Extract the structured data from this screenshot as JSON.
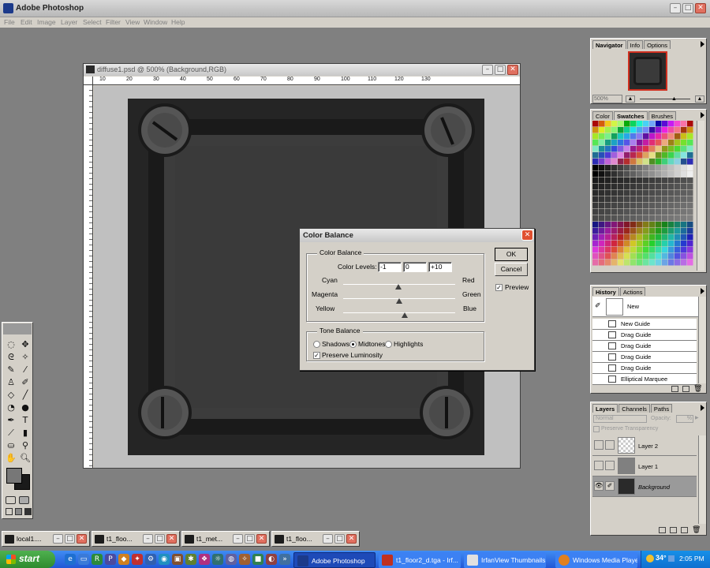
{
  "app": {
    "title": "Adobe Photoshop",
    "menu": [
      "File",
      "Edit",
      "Image",
      "Layer",
      "Select",
      "Filter",
      "View",
      "Window",
      "Help"
    ]
  },
  "document": {
    "title": "diffuse1.psd @ 500% (Background,RGB)",
    "ruler_labels": [
      "10",
      "20",
      "30",
      "40",
      "50",
      "60",
      "70",
      "80",
      "90",
      "100",
      "110",
      "120",
      "130"
    ]
  },
  "navigator": {
    "tabs": [
      "Navigator",
      "Info",
      "Options"
    ],
    "zoom": "500%"
  },
  "swatches_panel": {
    "tabs": [
      "Color",
      "Swatches",
      "Brushes"
    ]
  },
  "history": {
    "tabs": [
      "History",
      "Actions"
    ],
    "snapshot_label": "New",
    "items": [
      "New Guide",
      "Drag Guide",
      "Drag Guide",
      "Drag Guide",
      "Drag Guide",
      "Elliptical Marquee"
    ]
  },
  "layers": {
    "tabs": [
      "Layers",
      "Channels",
      "Paths"
    ],
    "blend_mode": "Normal",
    "opacity_label": "Opacity:",
    "opacity_value": "%",
    "preserve_label": "Preserve Transparency",
    "items": [
      "Layer 2",
      "Layer 1",
      "Background"
    ]
  },
  "dialog": {
    "title": "Color Balance",
    "group1": "Color Balance",
    "levels_label": "Color Levels:",
    "level_values": [
      "-1",
      "0",
      "+10"
    ],
    "left_labels": [
      "Cyan",
      "Magenta",
      "Yellow"
    ],
    "right_labels": [
      "Red",
      "Green",
      "Blue"
    ],
    "slider_levels": [
      -1,
      0,
      10
    ],
    "group2": "Tone Balance",
    "tones": [
      "Shadows",
      "Midtones",
      "Highlights"
    ],
    "selected_tone": "Midtones",
    "preserve": "Preserve Luminosity",
    "ok": "OK",
    "cancel": "Cancel",
    "preview": "Preview"
  },
  "minimized_windows": [
    "local1....",
    "t1_floo...",
    "t1_met...",
    "t1_floo..."
  ],
  "taskbar": {
    "start": "start",
    "tasks": [
      "Adobe Photoshop",
      "t1_floor2_d.tga - Irf...",
      "IrfanView Thumbnails",
      "Windows Media Player"
    ],
    "temperature": "34°",
    "clock": "2:05 PM"
  },
  "colors": {
    "xp_blue": "#3c81f3",
    "start_green": "#3c9a3c",
    "canvas_bg": "#2e2e2e",
    "navigator_border": "#d03020"
  }
}
